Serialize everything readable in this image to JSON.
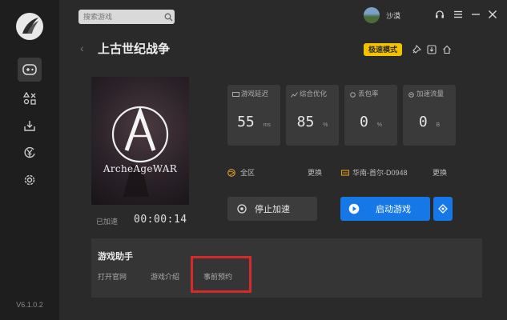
{
  "app": {
    "version": "V6.1.0.2"
  },
  "search": {
    "placeholder": "搜索游戏"
  },
  "user": {
    "name": "沙漠"
  },
  "game": {
    "title": "上古世纪战争",
    "cover_text": "ArcheAgeWAR",
    "mode_badge": "极速模式"
  },
  "timer": {
    "label": "已加速",
    "value": "00:00:14"
  },
  "stats": [
    {
      "label": "游戏延迟",
      "value": "55",
      "unit": "ms"
    },
    {
      "label": "综合优化",
      "value": "85",
      "unit": "%"
    },
    {
      "label": "丢包率",
      "value": "0",
      "unit": "%"
    },
    {
      "label": "加速流量",
      "value": "0",
      "unit": "B"
    }
  ],
  "region": {
    "zone": "全区",
    "server": "华南-首尔-D0948",
    "change_label": "更换"
  },
  "actions": {
    "stop_label": "停止加速",
    "start_label": "启动游戏"
  },
  "helper": {
    "title": "游戏助手",
    "links": [
      "打开官网",
      "游戏介绍",
      "事前预约"
    ]
  },
  "colors": {
    "accent": "#1677e6",
    "badge": "#f2c200",
    "highlight": "#d42a2a"
  }
}
